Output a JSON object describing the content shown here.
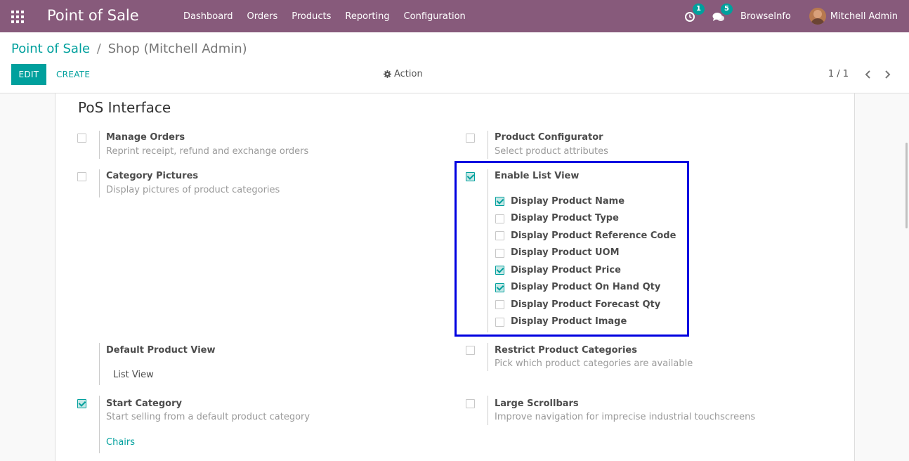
{
  "navbar": {
    "app_title": "Point of Sale",
    "menu": [
      "Dashboard",
      "Orders",
      "Products",
      "Reporting",
      "Configuration"
    ],
    "activity_count": "1",
    "message_count": "5",
    "company": "BrowseInfo",
    "user": "Mitchell Admin",
    "icons": [
      "apps-grid-icon",
      "activity-clock-icon",
      "chat-bubbles-icon",
      "avatar"
    ]
  },
  "control_panel": {
    "breadcrumb": {
      "parent": "Point of Sale",
      "separator": "/",
      "current": "Shop (Mitchell Admin)"
    },
    "edit_label": "EDIT",
    "create_label": "CREATE",
    "action_label": "Action",
    "pager": "1 / 1"
  },
  "form": {
    "section_title": "PoS Interface",
    "manage_orders": {
      "label": "Manage Orders",
      "desc": "Reprint receipt, refund and exchange orders",
      "checked": false
    },
    "product_configurator": {
      "label": "Product Configurator",
      "desc": "Select product attributes",
      "checked": false
    },
    "category_pictures": {
      "label": "Category Pictures",
      "desc": "Display pictures of product categories",
      "checked": false
    },
    "enable_list_view": {
      "label": "Enable List View",
      "checked": true,
      "options": [
        {
          "label": "Display Product Name",
          "checked": true
        },
        {
          "label": "Display Product Type",
          "checked": false
        },
        {
          "label": "Display Product Reference Code",
          "checked": false
        },
        {
          "label": "Display Product UOM",
          "checked": false
        },
        {
          "label": "Display Product Price",
          "checked": true
        },
        {
          "label": "Display Product On Hand Qty",
          "checked": true
        },
        {
          "label": "Display Product Forecast Qty",
          "checked": false
        },
        {
          "label": "Display Product Image",
          "checked": false
        }
      ]
    },
    "default_product_view": {
      "label": "Default Product View",
      "value": "List View"
    },
    "restrict_categories": {
      "label": "Restrict Product Categories",
      "desc": "Pick which product categories are available",
      "checked": false
    },
    "start_category": {
      "label": "Start Category",
      "desc": "Start selling from a default product category",
      "value": "Chairs",
      "checked": true
    },
    "large_scrollbars": {
      "label": "Large Scrollbars",
      "desc": "Improve navigation for imprecise industrial touchscreens",
      "checked": false
    }
  },
  "colors": {
    "navbar": "#875a7b",
    "accent": "#00a09d",
    "highlight": "#0000e0"
  }
}
